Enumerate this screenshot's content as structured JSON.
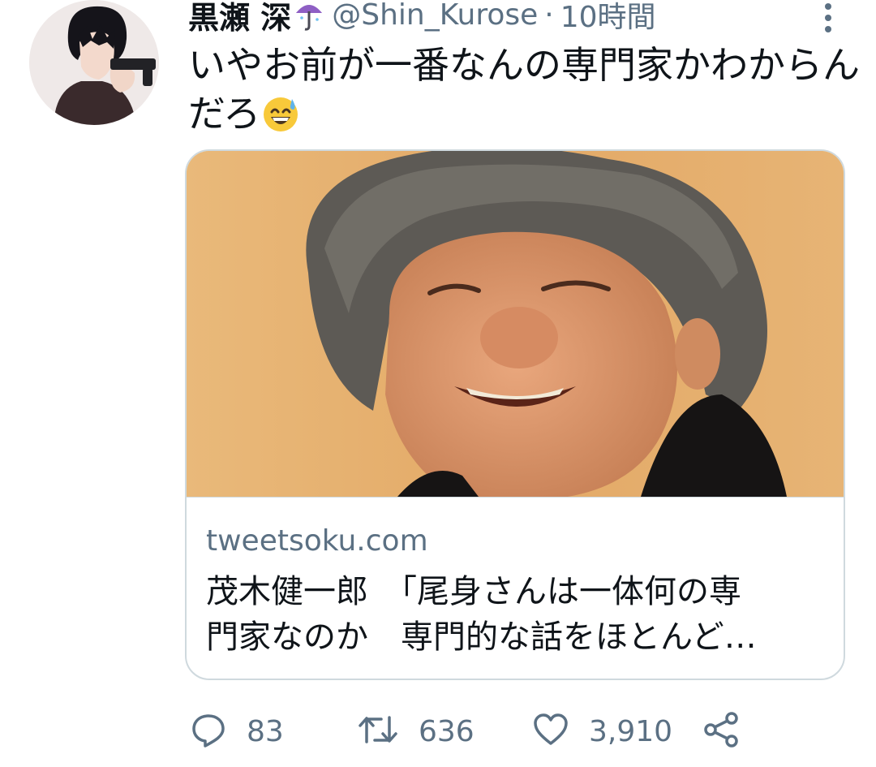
{
  "tweet": {
    "display_name": "黒瀬 深",
    "name_emoji": "umbrella-with-rain-icon",
    "handle": "@Shin_Kurose",
    "separator": "·",
    "time": "10時間",
    "text_lines": [
      "いやお前が一番なんの専門家かわからん",
      "だろ"
    ],
    "text_emoji": "grinning-sweat-emoji"
  },
  "card": {
    "domain": "tweetsoku.com",
    "title_lines": [
      "茂木健一郎　「尾身さんは一体何の専",
      "門家なのか　専門的な話をほとんど…"
    ]
  },
  "actions": {
    "reply_count": "83",
    "retweet_count": "636",
    "like_count": "3,910"
  },
  "colors": {
    "text_primary": "#0f1419",
    "text_secondary": "#5b7083",
    "border": "#cfd9de"
  }
}
